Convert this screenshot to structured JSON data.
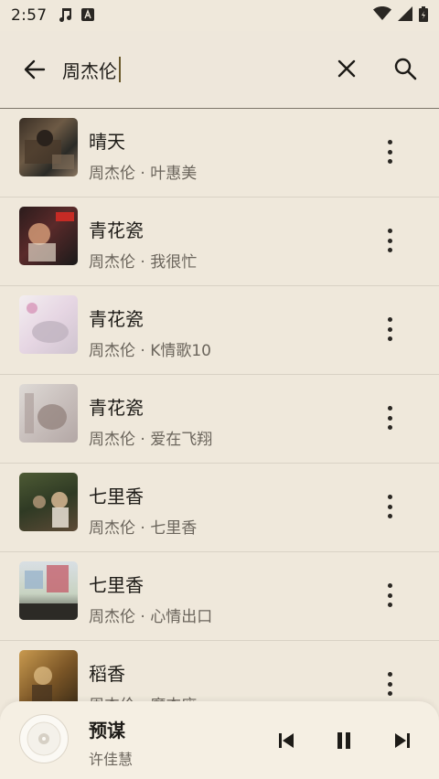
{
  "status": {
    "time": "2:57",
    "icons": [
      "music-note-icon",
      "app-a-icon",
      "wifi-icon",
      "signal-icon",
      "battery-icon"
    ]
  },
  "search": {
    "query": "周杰伦",
    "back_icon": "arrow-left-icon",
    "clear_icon": "close-icon",
    "search_icon": "search-icon"
  },
  "songs": [
    {
      "title": "晴天",
      "subtitle": "周杰伦 · 叶惠美"
    },
    {
      "title": "青花瓷",
      "subtitle": "周杰伦 · 我很忙"
    },
    {
      "title": "青花瓷",
      "subtitle": "周杰伦 · K情歌10"
    },
    {
      "title": "青花瓷",
      "subtitle": "周杰伦 · 爱在飞翔"
    },
    {
      "title": "七里香",
      "subtitle": "周杰伦 · 七里香"
    },
    {
      "title": "七里香",
      "subtitle": "周杰伦 · 心情出口"
    },
    {
      "title": "稻香",
      "subtitle": "周杰伦 · 魔杰座"
    }
  ],
  "player": {
    "title": "预谋",
    "artist": "许佳慧",
    "controls": [
      "skip-previous-icon",
      "pause-icon",
      "skip-next-icon"
    ]
  },
  "colors": {
    "background": "#efe8db",
    "text_primary": "#1d1b17",
    "text_secondary": "#6b655c",
    "caret": "#6b5a2c"
  }
}
